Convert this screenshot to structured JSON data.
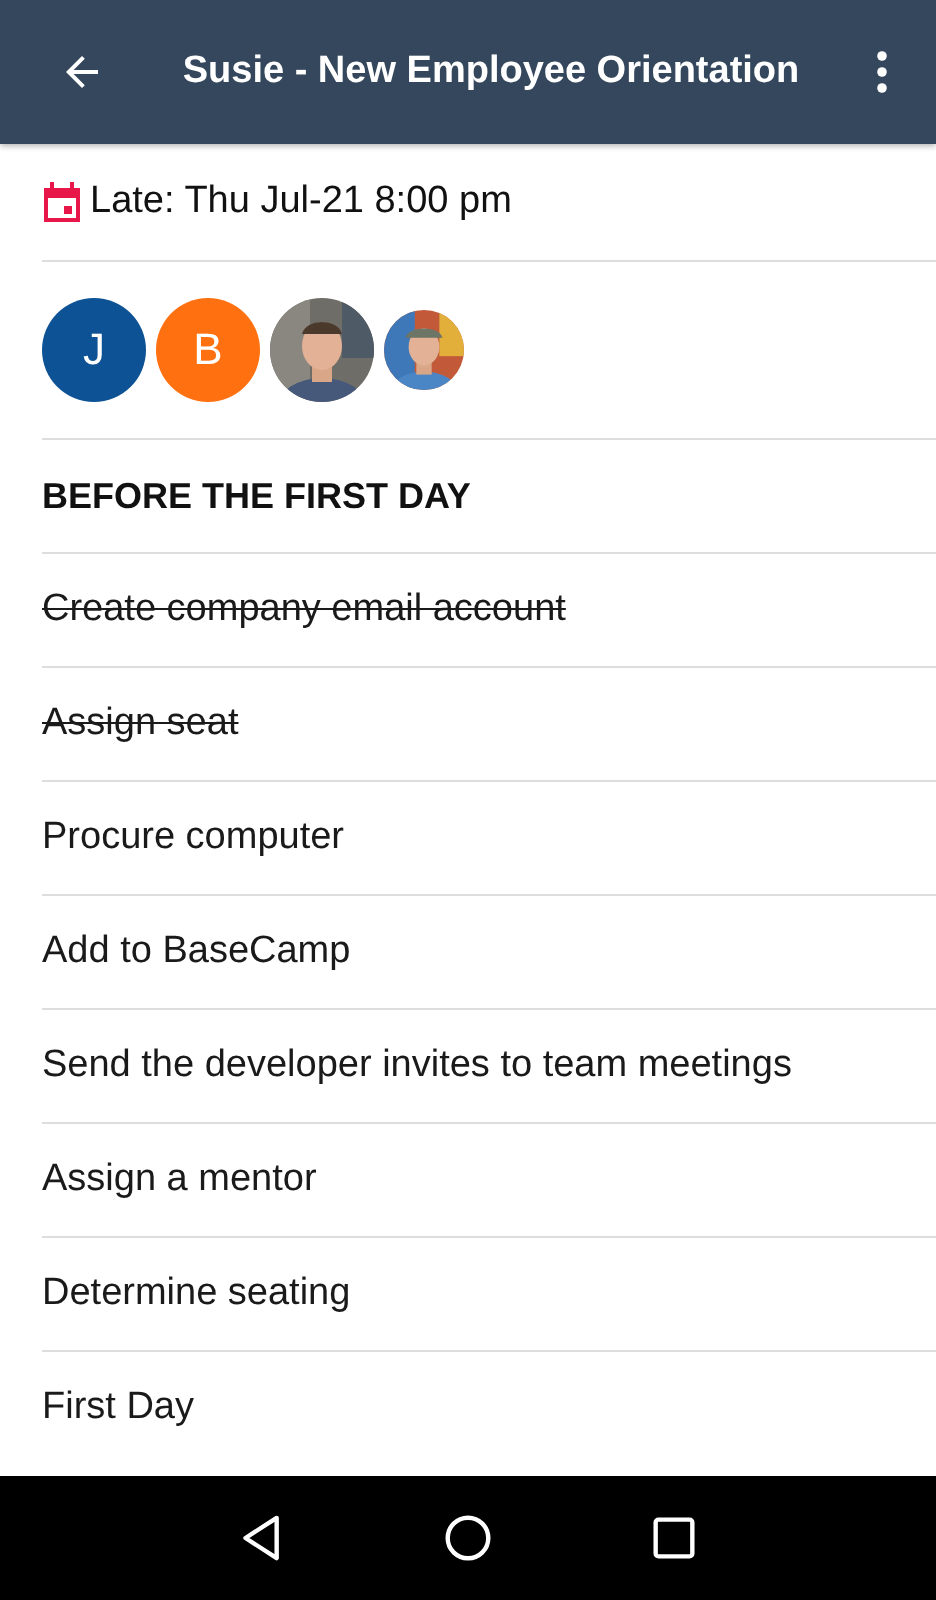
{
  "app_bar": {
    "title": "Susie - New Employee Orientation"
  },
  "due": {
    "text": "Late: Thu Jul-21 8:00 pm",
    "late": true
  },
  "assignees": [
    {
      "kind": "initial",
      "letter": "J",
      "color": "#0d5294"
    },
    {
      "kind": "initial",
      "letter": "B",
      "color": "#ff7010"
    },
    {
      "kind": "picture"
    },
    {
      "kind": "picture"
    }
  ],
  "items": [
    {
      "kind": "section",
      "text": "BEFORE THE FIRST DAY"
    },
    {
      "kind": "task",
      "text": "Create company email account",
      "done": true
    },
    {
      "kind": "task",
      "text": "Assign seat",
      "done": true
    },
    {
      "kind": "task",
      "text": "Procure computer",
      "done": false
    },
    {
      "kind": "task",
      "text": "Add to BaseCamp",
      "done": false
    },
    {
      "kind": "task",
      "text": "Send the developer invites to team meetings",
      "done": false
    },
    {
      "kind": "task",
      "text": "Assign a mentor",
      "done": false
    },
    {
      "kind": "task",
      "text": "Determine seating",
      "done": false
    },
    {
      "kind": "task",
      "text": "First Day",
      "done": false
    }
  ]
}
